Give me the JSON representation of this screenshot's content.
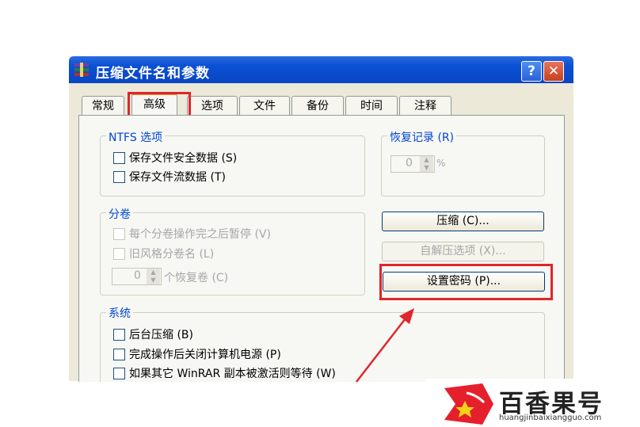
{
  "window": {
    "title": "压缩文件名和参数",
    "help": "?",
    "close": "✕"
  },
  "tabs": [
    {
      "label": "常规"
    },
    {
      "label": "高级"
    },
    {
      "label": "选项"
    },
    {
      "label": "文件"
    },
    {
      "label": "备份"
    },
    {
      "label": "时间"
    },
    {
      "label": "注释"
    }
  ],
  "active_tab": "高级",
  "ntfs": {
    "title": "NTFS 选项",
    "items": [
      {
        "label": "保存文件安全数据 (S)",
        "checked": false
      },
      {
        "label": "保存文件流数据 (T)",
        "checked": false
      }
    ]
  },
  "recovery": {
    "title": "恢复记录 (R)",
    "value": "0",
    "unit": "%"
  },
  "volume": {
    "title": "分卷",
    "items": [
      {
        "label": "每个分卷操作完之后暂停 (V)",
        "checked": false
      },
      {
        "label": "旧风格分卷名 (L)",
        "checked": false
      }
    ],
    "spin_value": "0",
    "spin_label": "个恢复卷 (C)"
  },
  "buttons": {
    "compress": "压缩 (C)...",
    "sfx": "自解压选项 (X)...",
    "password": "设置密码 (P)..."
  },
  "system": {
    "title": "系统",
    "items": [
      {
        "label": "后台压缩 (B)",
        "checked": false
      },
      {
        "label": "完成操作后关闭计算机电源 (P)",
        "checked": false
      },
      {
        "label": "如果其它 WinRAR 副本被激活则等待 (W)",
        "checked": false
      }
    ]
  },
  "watermark": {
    "brand": "百香果号",
    "url": "huangjinbaixiangguo.com"
  },
  "colors": {
    "highlight": "#e0252b",
    "titlebar": "#0b50d4",
    "logo": "#e5202c"
  }
}
